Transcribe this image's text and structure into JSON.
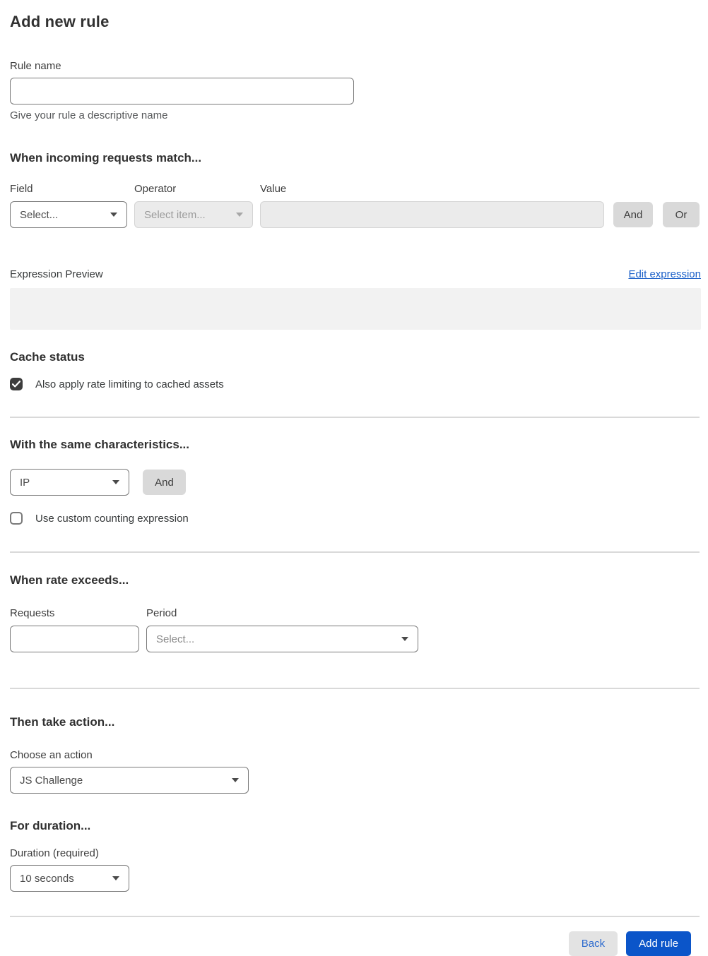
{
  "page": {
    "title": "Add new rule"
  },
  "colors": {
    "primary_blue": "#0b55c9",
    "link_blue": "#1a5fc8",
    "disabled_bg": "#ebebeb",
    "gray_button": "#d9d9d9",
    "preview_bg": "#f2f2f2",
    "checkbox_checked": "#3d3d3d"
  },
  "rule_name": {
    "label": "Rule name",
    "value": "",
    "help": "Give your rule a descriptive name"
  },
  "match": {
    "heading": "When incoming requests match...",
    "field": {
      "label": "Field",
      "selected": "Select..."
    },
    "operator": {
      "label": "Operator",
      "selected": "Select item..."
    },
    "value": {
      "label": "Value",
      "value": ""
    },
    "and_label": "And",
    "or_label": "Or",
    "expression_preview_label": "Expression Preview",
    "edit_expression_label": "Edit expression",
    "expression_value": ""
  },
  "cache_status": {
    "heading": "Cache status",
    "checkbox_label": "Also apply rate limiting to cached assets",
    "checked": true
  },
  "characteristics": {
    "heading": "With the same characteristics...",
    "selected": "IP",
    "and_label": "And",
    "checkbox_label": "Use custom counting expression",
    "checked": false
  },
  "rate": {
    "heading": "When rate exceeds...",
    "requests": {
      "label": "Requests",
      "value": ""
    },
    "period": {
      "label": "Period",
      "selected": "Select..."
    }
  },
  "action": {
    "heading": "Then take action...",
    "choose_label": "Choose an action",
    "selected": "JS Challenge"
  },
  "duration": {
    "heading": "For duration...",
    "label": "Duration (required)",
    "selected": "10 seconds"
  },
  "footer": {
    "back_label": "Back",
    "add_rule_label": "Add rule"
  }
}
